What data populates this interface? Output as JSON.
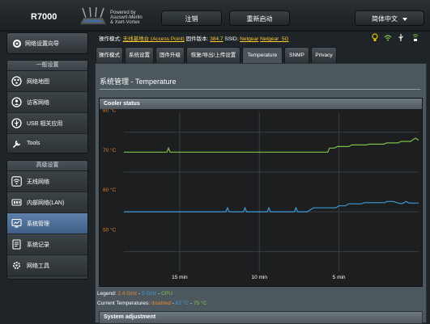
{
  "header": {
    "brand": "R7000",
    "powered_by": [
      "Powered by",
      "Asuswrt-Merlin",
      "& Xwrt-Vortex"
    ],
    "logout": "注销",
    "reboot": "重新启动",
    "language": "简体中文"
  },
  "sidebar": {
    "quick_setup": "网络设置向导",
    "general_title": "一般设置",
    "general_items": [
      {
        "label": "网络地图",
        "icon": "network-map-icon"
      },
      {
        "label": "访客网络",
        "icon": "guest-network-icon"
      },
      {
        "label": "USB 相关应用",
        "icon": "usb-icon"
      },
      {
        "label": "Tools",
        "icon": "tools-icon"
      }
    ],
    "advanced_title": "高级设置",
    "advanced_items": [
      {
        "label": "无线网络",
        "icon": "wireless-icon"
      },
      {
        "label": "内部网络(LAN)",
        "icon": "lan-icon"
      },
      {
        "label": "系统管理",
        "icon": "administration-icon",
        "active": true
      },
      {
        "label": "系统记录",
        "icon": "system-log-icon"
      },
      {
        "label": "网络工具",
        "icon": "network-tools-icon"
      }
    ]
  },
  "status": {
    "mode_label": "操作模式:",
    "mode_value": "无线基地台 (Access Point)",
    "firmware_label": "固件版本:",
    "firmware_value": "384.7",
    "ssid_label": "SSID:",
    "ssid_1": "Netgear",
    "ssid_2": "Netgear_5G",
    "icons": [
      "lightbulb-icon",
      "wifi-icon",
      "usb-status-icon",
      "dual-band-icon"
    ]
  },
  "tabs": [
    "操作模式",
    "系统设置",
    "固件升级",
    "恢复/导出/上传设置",
    "Temperature",
    "SNMP",
    "Privacy"
  ],
  "active_tab": "Temperature",
  "page": {
    "title": "系统管理 - Temperature",
    "cooler_header": "Cooler status",
    "legend_prefix": "Legend:",
    "legend_24": "2.4 GHz",
    "legend_5": "5 GHz",
    "legend_cpu": "CPU",
    "legend_sep": "-",
    "current_prefix": "Current Temperatures:",
    "current_24": "disabled",
    "current_5": "62 °C",
    "current_cpu": "75 °C",
    "system_adjust": "System adjustment"
  },
  "colors": {
    "series_24": "#e08b2f",
    "series_5": "#3d9ad9",
    "series_cpu": "#7fc04a",
    "active_nav": "#4f6f96"
  },
  "chart_data": {
    "type": "line",
    "ylim": [
      45,
      85
    ],
    "yticks": [
      80,
      70,
      60,
      50
    ],
    "ytick_labels": [
      "80 °C",
      "70 °C",
      "60 °C",
      "50 °C"
    ],
    "xlim": [
      -18.5,
      0
    ],
    "xticks": [
      -15,
      -10,
      -5
    ],
    "xtick_labels": [
      "15 min",
      "10 min",
      "5 min"
    ],
    "series": [
      {
        "name": "CPU",
        "x": [
          -18.5,
          -15.8,
          -15.7,
          -15.6,
          -5.7,
          -5.6,
          -5.3,
          -5.1,
          -4.4,
          -4.2,
          -3.3,
          -3.1,
          -2.2,
          -2.0,
          -1.3,
          -1.1,
          -0.5,
          -0.4,
          -0.2,
          0
        ],
        "y": [
          75,
          75,
          76,
          75,
          75,
          76,
          76,
          76.4,
          76.4,
          76.8,
          76.8,
          77,
          77,
          77.3,
          77.3,
          77.7,
          77.7,
          78,
          78.5,
          78
        ]
      },
      {
        "name": "5 GHz",
        "x": [
          -18.5,
          -12.1,
          -12.0,
          -11.9,
          -11.0,
          -10.9,
          -10.8,
          -9.5,
          -9.4,
          -9.3,
          -7.8,
          -7.7,
          -7.6,
          -7.0,
          -6.6,
          -6.0,
          -5.2,
          -5.0,
          -4.6,
          -4.4,
          -3.6,
          -3.4,
          -2.1,
          -2.0,
          -1.6,
          -1.2,
          -1.0,
          -0.8,
          -0.6,
          0
        ],
        "y": [
          60,
          60,
          61,
          60,
          60,
          61,
          60,
          60,
          61,
          60,
          60,
          61,
          60,
          60,
          61,
          61,
          61,
          61.5,
          61.5,
          62,
          62,
          62.3,
          62.3,
          62.6,
          62.6,
          62.1,
          62.1,
          62.6,
          62.2,
          62.2
        ]
      }
    ]
  }
}
